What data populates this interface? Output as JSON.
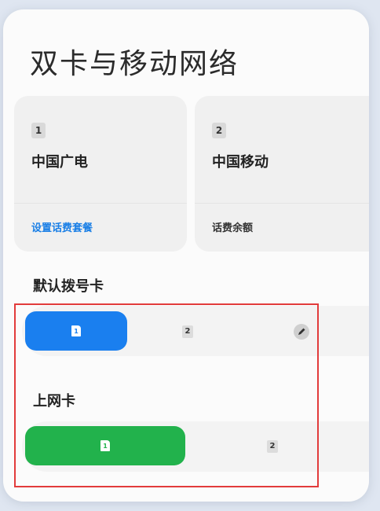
{
  "page": {
    "title": "双卡与移动网络"
  },
  "sim_cards": [
    {
      "slot": "1",
      "carrier": "中国广电",
      "action": "设置话费套餐"
    },
    {
      "slot": "2",
      "carrier": "中国移动",
      "action": "话费余额"
    }
  ],
  "default_dial": {
    "label": "默认拨号卡",
    "options": [
      "1",
      "2"
    ],
    "selected": "1"
  },
  "data_sim": {
    "label": "上网卡",
    "options": [
      "1",
      "2"
    ],
    "selected": "1"
  },
  "colors": {
    "accent_blue": "#1a7fef",
    "accent_green": "#22b24c",
    "link": "#1a7fe6",
    "highlight": "#e23b3b"
  },
  "icons": {
    "edit": "pencil-icon",
    "sim": "sim-card-icon"
  }
}
